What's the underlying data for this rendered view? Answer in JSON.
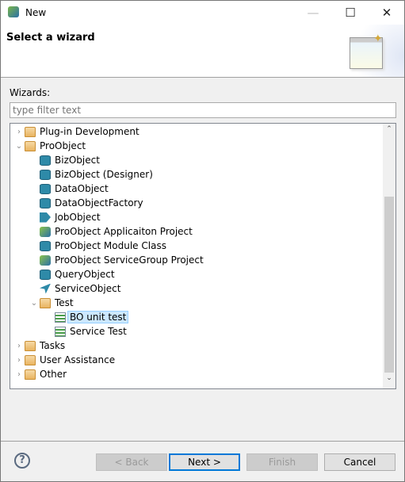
{
  "window": {
    "title": "New",
    "minimize": "—",
    "maximize": "☐",
    "close": "✕"
  },
  "header": {
    "title": "Select a wizard",
    "sparkle": "✦"
  },
  "wizards_label": "Wizards:",
  "filter": {
    "value": "",
    "placeholder": "type filter text"
  },
  "tree": [
    {
      "level": 0,
      "chevron": ">",
      "icon": "folder",
      "label": "Plug-in Development"
    },
    {
      "level": 0,
      "chevron": "v",
      "icon": "folder",
      "label": "ProObject"
    },
    {
      "level": 1,
      "icon": "cyl",
      "label": "BizObject"
    },
    {
      "level": 1,
      "icon": "cyl",
      "label": "BizObject (Designer)"
    },
    {
      "level": 1,
      "icon": "cyl",
      "label": "DataObject"
    },
    {
      "level": 1,
      "icon": "cyl",
      "label": "DataObjectFactory"
    },
    {
      "level": 1,
      "icon": "job",
      "label": "JobObject"
    },
    {
      "level": 1,
      "icon": "proj",
      "label": "ProObject Applicaiton Project"
    },
    {
      "level": 1,
      "icon": "cyl",
      "label": "ProObject Module Class"
    },
    {
      "level": 1,
      "icon": "proj",
      "label": "ProObject ServiceGroup Project"
    },
    {
      "level": 1,
      "icon": "cyl",
      "label": "QueryObject"
    },
    {
      "level": 1,
      "icon": "svc",
      "label": "ServiceObject"
    },
    {
      "level": 1,
      "chevron": "v",
      "icon": "folder",
      "label": "Test"
    },
    {
      "level": 2,
      "icon": "list",
      "label": "BO unit test",
      "selected": true
    },
    {
      "level": 2,
      "icon": "list",
      "label": "Service Test"
    },
    {
      "level": 0,
      "chevron": ">",
      "icon": "folder",
      "label": "Tasks"
    },
    {
      "level": 0,
      "chevron": ">",
      "icon": "folder",
      "label": "User Assistance"
    },
    {
      "level": 0,
      "chevron": ">",
      "icon": "folder",
      "label": "Other"
    }
  ],
  "scrollbar": {
    "up": "⌃",
    "down": "⌄"
  },
  "buttons": {
    "help": "?",
    "back": "< Back",
    "next": "Next >",
    "finish": "Finish",
    "cancel": "Cancel"
  }
}
